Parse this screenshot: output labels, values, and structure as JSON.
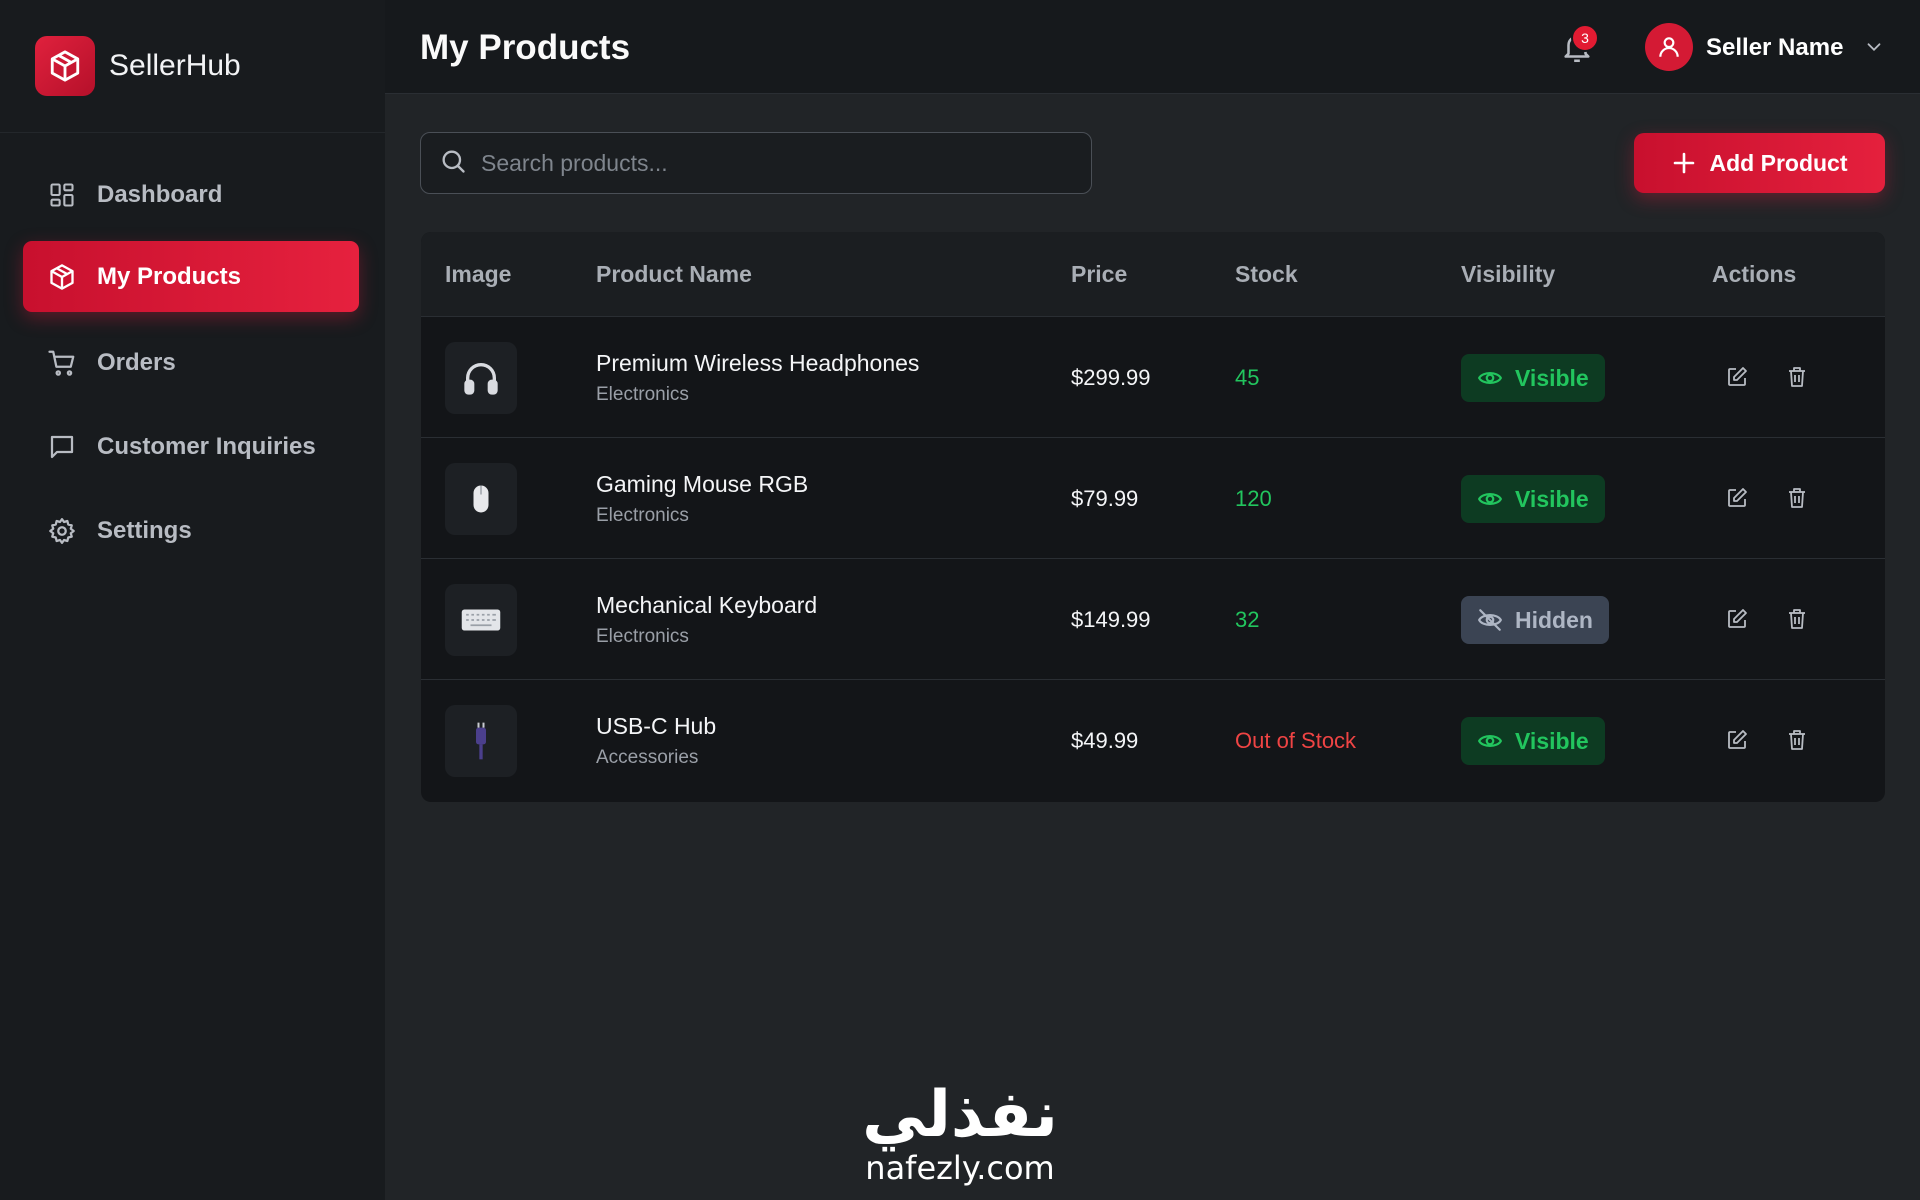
{
  "brand": {
    "name": "SellerHub"
  },
  "sidebar": {
    "items": [
      {
        "label": "Dashboard",
        "icon": "dashboard-grid-icon"
      },
      {
        "label": "My Products",
        "icon": "box-icon",
        "active": true
      },
      {
        "label": "Orders",
        "icon": "cart-icon"
      },
      {
        "label": "Customer Inquiries",
        "icon": "message-icon"
      },
      {
        "label": "Settings",
        "icon": "gear-icon"
      }
    ]
  },
  "header": {
    "title": "My Products",
    "notifications_count": "3",
    "user_name": "Seller Name"
  },
  "search": {
    "placeholder": "Search products..."
  },
  "toolbar": {
    "add_label": "Add Product"
  },
  "table": {
    "columns": [
      "Image",
      "Product Name",
      "Price",
      "Stock",
      "Visibility",
      "Actions"
    ],
    "rows": [
      {
        "name": "Premium Wireless Headphones",
        "category": "Electronics",
        "price": "$299.99",
        "stock": "45",
        "stock_status": "in",
        "visibility": "Visible",
        "thumb": "headphones-icon"
      },
      {
        "name": "Gaming Mouse RGB",
        "category": "Electronics",
        "price": "$79.99",
        "stock": "120",
        "stock_status": "in",
        "visibility": "Visible",
        "thumb": "mouse-icon"
      },
      {
        "name": "Mechanical Keyboard",
        "category": "Electronics",
        "price": "$149.99",
        "stock": "32",
        "stock_status": "in",
        "visibility": "Hidden",
        "thumb": "keyboard-icon"
      },
      {
        "name": "USB-C Hub",
        "category": "Accessories",
        "price": "$49.99",
        "stock": "Out of Stock",
        "stock_status": "out",
        "visibility": "Visible",
        "thumb": "usb-hub-icon"
      }
    ]
  },
  "colors": {
    "accent": "#e11d39",
    "stock_in": "#22c55e",
    "stock_out": "#ef4444",
    "visible_bg": "#0d3b22",
    "hidden_bg": "#3b4453"
  },
  "watermark": {
    "arabic": "نفذلي",
    "latin": "nafezly.com"
  }
}
